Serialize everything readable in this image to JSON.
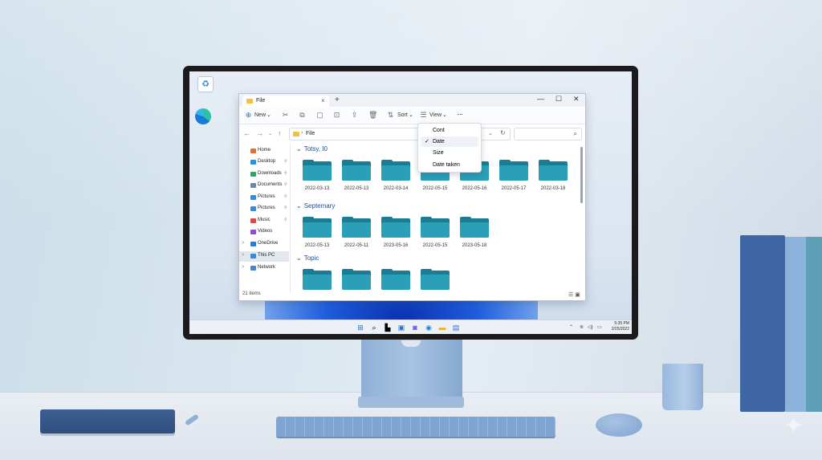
{
  "window": {
    "tab_title": "File",
    "tab_close": "×",
    "new_tab": "+",
    "controls": {
      "minimize": "—",
      "maximize": "☐",
      "close": "✕"
    }
  },
  "toolbar": {
    "new_label": "New",
    "new_caret": "⌄",
    "sort_label": "Sort",
    "view_label": "View",
    "more_label": "···",
    "icons": [
      "cut-icon",
      "copy-icon",
      "paste-icon",
      "rename-icon",
      "share-icon",
      "delete-icon"
    ]
  },
  "address": {
    "path": "File",
    "search_placeholder": "",
    "search_glyph": "⌕"
  },
  "sidebar": {
    "items": [
      {
        "label": "Home",
        "icon": "home-icon",
        "color": "#d9743a"
      },
      {
        "label": "Desktop",
        "icon": "desktop-icon",
        "color": "#2f8fd8",
        "pinned": true
      },
      {
        "label": "Downloads",
        "icon": "downloads-icon",
        "color": "#3aa06a",
        "pinned": true
      },
      {
        "label": "Documents",
        "icon": "documents-icon",
        "color": "#6d87a8",
        "pinned": true
      },
      {
        "label": "Pictures",
        "icon": "pictures-icon",
        "color": "#3b8ad6",
        "pinned": true
      },
      {
        "label": "Pictures",
        "icon": "pictures-icon",
        "color": "#3b8ad6",
        "pinned": true
      },
      {
        "label": "Music",
        "icon": "music-icon",
        "color": "#d94a4a",
        "pinned": true
      },
      {
        "label": "Videos",
        "icon": "videos-icon",
        "color": "#8a4fd0"
      },
      {
        "label": "OneDrive",
        "icon": "onedrive-icon",
        "color": "#2d7ad6",
        "expander": true
      },
      {
        "label": "This PC",
        "icon": "this-pc-icon",
        "color": "#3a8bd0",
        "expander": true,
        "selected": true
      },
      {
        "label": "Network",
        "icon": "network-icon",
        "color": "#4c86c6",
        "expander": true
      }
    ],
    "pin_glyph": "📌",
    "expander_glyph": ">"
  },
  "groups": [
    {
      "title": "Totsy, I0",
      "folders": [
        "2022-03-13",
        "2022-05-13",
        "2022-03-14",
        "2022-05-15",
        "2022-05-16",
        "2022-05-17",
        "2022-03-18"
      ]
    },
    {
      "title": "Septemary",
      "folders": [
        "2022-05-13",
        "2022-05-11",
        "2023-05-16",
        "2022-05-15",
        "2023-05-18"
      ]
    },
    {
      "title": "Topic",
      "folders": [
        "",
        "",
        "",
        ""
      ]
    }
  ],
  "group_chevron": "⌄",
  "status": {
    "items_count": "21 items"
  },
  "view_menu": {
    "items": [
      {
        "label": "Cont",
        "checked": false
      },
      {
        "label": "Date",
        "checked": true
      },
      {
        "label": "Size",
        "checked": false
      },
      {
        "label": "Date taken",
        "checked": false
      }
    ],
    "check_glyph": "✓"
  },
  "taskbar": {
    "icons": [
      "start-icon",
      "search-icon",
      "task-view-icon",
      "widgets-icon",
      "chat-icon",
      "edge-icon",
      "file-explorer-icon",
      "store-icon"
    ],
    "tray": {
      "caret": "⌃",
      "wifi": "wifi",
      "volume": "◁",
      "battery": "battery"
    },
    "time": "5:35 PM",
    "date": "2/25/2022"
  },
  "colors": {
    "accent": "#1f4e8f",
    "folder_dark": "#1a7d94",
    "folder_light": "#2b9fb8"
  }
}
